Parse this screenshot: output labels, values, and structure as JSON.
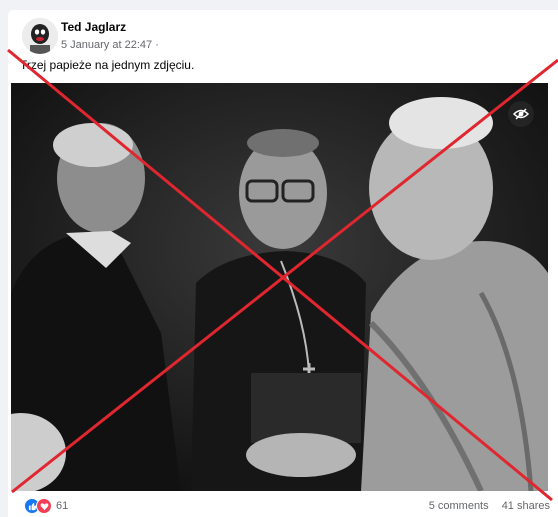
{
  "post": {
    "author": "Ted Jaglarz",
    "date": "5 January at 22:47",
    "separator": "·",
    "caption": "Trzej papieże na jednym zdjęciu.",
    "photo_icon": "eye-off-icon"
  },
  "footer": {
    "reactions_count": "61",
    "reaction_icons": [
      "like-icon",
      "love-icon"
    ],
    "comments": "5 comments",
    "shares": "41 shares"
  },
  "colors": {
    "cross": "#e0262e",
    "like": "#1877f2",
    "love": "#f33e58"
  }
}
